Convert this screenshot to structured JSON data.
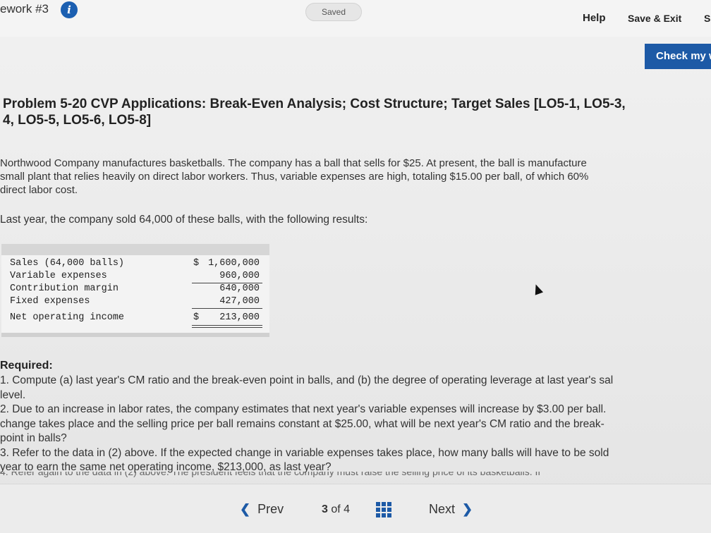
{
  "header": {
    "assignment_title": "ework #3",
    "info_glyph": "i",
    "saved_label": "Saved",
    "help_label": "Help",
    "save_exit_label": "Save & Exit",
    "submit_label": "S",
    "check_label": "Check my w"
  },
  "problem": {
    "title_line1": "Problem 5-20 CVP Applications: Break-Even Analysis; Cost Structure; Target Sales [LO5-1, LO5-3,",
    "title_line2": "4, LO5-5, LO5-6, LO5-8]",
    "intro_line1": "Northwood Company manufactures basketballs. The company has a ball that sells for $25. At present, the ball is manufacture",
    "intro_line2": "small plant that relies heavily on direct labor workers. Thus, variable expenses are high, totaling $15.00 per ball, of which 60%",
    "intro_line3": "direct labor cost.",
    "lead": "Last year, the company sold 64,000 of these balls, with the following results:"
  },
  "income_statement": {
    "rows": [
      {
        "label": "Sales (64,000 balls)",
        "currency": "$",
        "amount": "1,600,000"
      },
      {
        "label": "Variable expenses",
        "currency": "",
        "amount": "960,000"
      },
      {
        "label": "Contribution margin",
        "currency": "",
        "amount": "640,000"
      },
      {
        "label": "Fixed expenses",
        "currency": "",
        "amount": "427,000"
      },
      {
        "label": "Net operating income",
        "currency": "$",
        "amount": "213,000"
      }
    ]
  },
  "required": {
    "heading": "Required:",
    "q1_line1": "1. Compute (a) last year's CM ratio and the break-even point in balls, and (b) the degree of operating leverage at last year's sal",
    "q1_line2": "level.",
    "q2_line1": "2. Due to an increase in labor rates, the company estimates that next year's variable expenses will increase by $3.00 per ball.",
    "q2_line2": "change takes place and the selling price per ball remains constant at $25.00, what will be next year's CM ratio and the break-",
    "q2_line3": "point in balls?",
    "q3_line1": "3. Refer to the data in (2) above. If the expected change in variable expenses takes place, how many balls will have to be sold",
    "q3_line2": "year to earn the same net operating income, $213,000, as last year?",
    "q4_partial": "4. Refer again to the data in (2) above. The president feels that the company must raise the selling price of its basketballs. If"
  },
  "navigation": {
    "prev_label": "Prev",
    "current_page": "3",
    "of_label": "of",
    "total_pages": "4",
    "next_label": "Next"
  },
  "colors": {
    "accent": "#1d5aa6",
    "info_icon": "#1b5fb1"
  },
  "icons": {
    "info": "info-icon",
    "prev": "chevron-left-icon",
    "next": "chevron-right-icon",
    "grid": "grid-icon",
    "cursor": "mouse-cursor-icon"
  }
}
